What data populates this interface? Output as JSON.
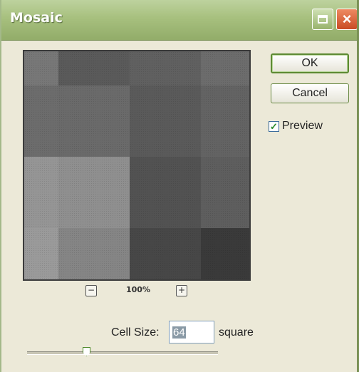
{
  "window": {
    "title": "Mosaic"
  },
  "titlebar": {
    "close_glyph": "×"
  },
  "buttons": {
    "ok_label": "OK",
    "cancel_label": "Cancel"
  },
  "preview_option": {
    "label": "Preview",
    "checked": true,
    "check_glyph": "✓"
  },
  "zoom": {
    "out_glyph": "−",
    "in_glyph": "+",
    "level": "100%"
  },
  "cell_size": {
    "label": "Cell Size:",
    "value": "64",
    "unit": "square"
  },
  "preview_colors": [
    [
      "#777777",
      "#5a5a5a",
      "#606060",
      "#6c6c6c"
    ],
    [
      "#6c6c6c",
      "#6a6a6a",
      "#5a5a5a",
      "#636363"
    ],
    [
      "#959595",
      "#8f8f8f",
      "#525252",
      "#5e5e5e"
    ],
    [
      "#9a9a9a",
      "#858585",
      "#474747",
      "#3a3a3a"
    ]
  ],
  "colors": {
    "titlebar": "#a7c07e",
    "dialog_bg": "#ece9d8",
    "ok_border": "#5d8a33",
    "close_button": "#c94b25"
  }
}
